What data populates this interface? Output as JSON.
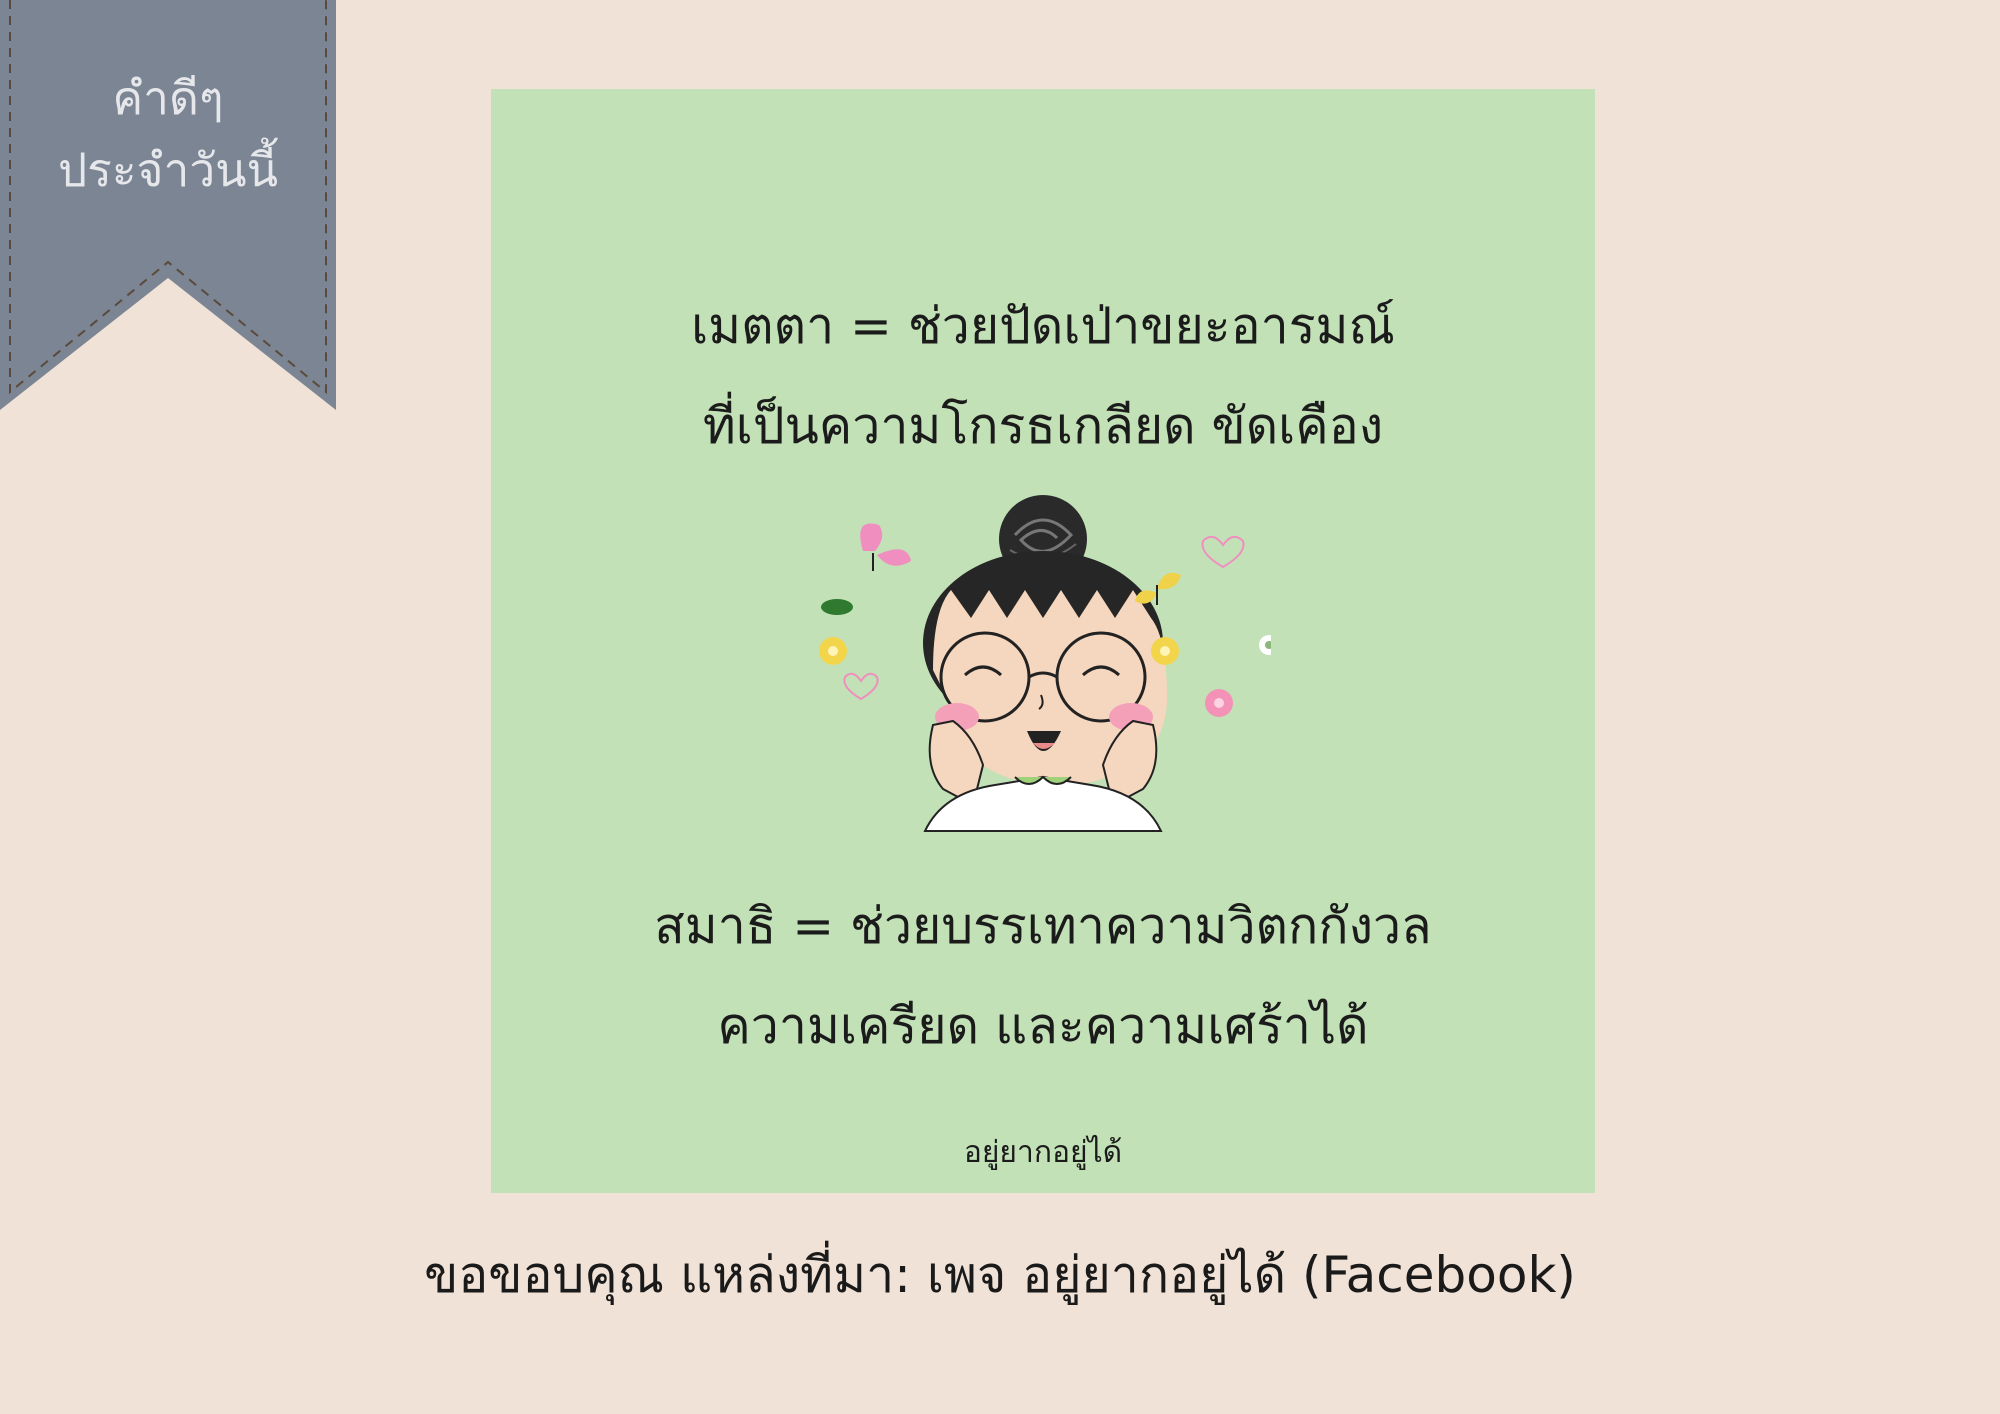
{
  "ribbon": {
    "line1": "คำดีๆ",
    "line2": "ประจำวันนี้",
    "color": "#7b8593"
  },
  "card": {
    "background": "#c2e1b7",
    "lines": [
      "เมตตา = ช่วยปัดเป่าขยะอารมณ์",
      "ที่เป็นความโกรธเกลียด ขัดเคือง",
      "สมาธิ = ช่วยบรรเทาความวิตกกังวล",
      "ความเครียด และความเศร้าได้"
    ],
    "signature": "อยู่ยากอยู่ได้"
  },
  "illustration": {
    "subject": "smiling girl with hair bun, round glasses and hands on cheeks",
    "decorations": [
      "butterfly-icon",
      "heart-icon",
      "flower-icon",
      "leaf-icon"
    ]
  },
  "credit": "ขอขอบคุณ แหล่งที่มา: เพจ อยู่ยากอยู่ได้ (Facebook)"
}
